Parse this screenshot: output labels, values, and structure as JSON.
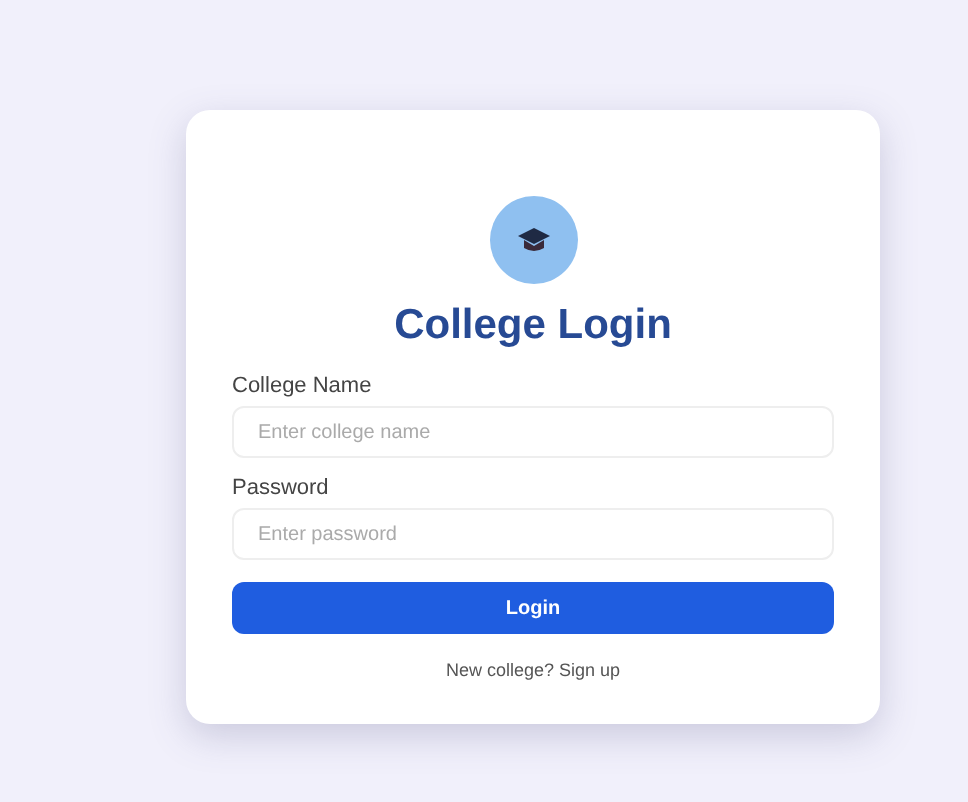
{
  "card": {
    "title": "College Login",
    "fields": [
      {
        "label": "College Name",
        "placeholder": "Enter college name"
      },
      {
        "label": "Password",
        "placeholder": "Enter password"
      }
    ],
    "button": "Login",
    "link": "New college? Sign up"
  }
}
